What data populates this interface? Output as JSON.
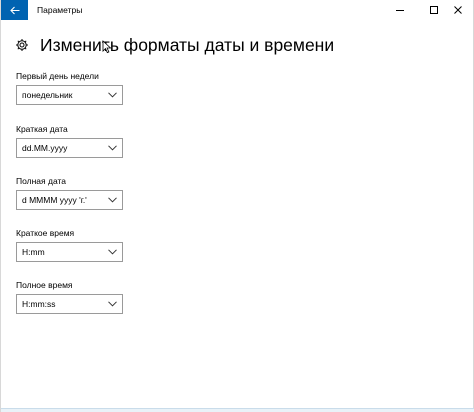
{
  "window": {
    "title": "Параметры"
  },
  "page": {
    "title": "Изменить форматы даты и времени"
  },
  "fields": [
    {
      "label": "Первый день недели",
      "value": "понедельник"
    },
    {
      "label": "Краткая дата",
      "value": "dd.MM.yyyy"
    },
    {
      "label": "Полная дата",
      "value": "d MMMM yyyy 'г.'"
    },
    {
      "label": "Краткое время",
      "value": "H:mm"
    },
    {
      "label": "Полное время",
      "value": "H:mm:ss"
    }
  ],
  "colors": {
    "accent": "#0063b1",
    "border": "#9a9a9a"
  },
  "icons": {
    "back": "arrow-left-icon",
    "settings": "gear-icon",
    "minimize": "minimize-icon",
    "maximize": "maximize-icon",
    "close": "close-icon",
    "dropdown": "chevron-down-icon"
  }
}
